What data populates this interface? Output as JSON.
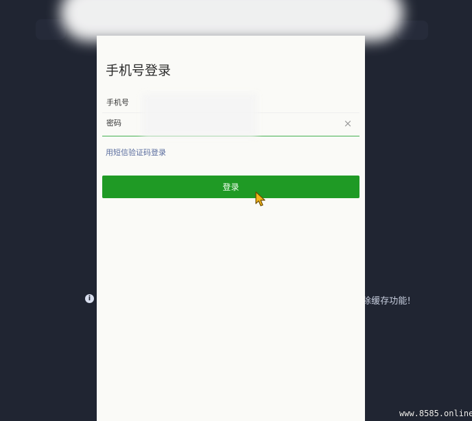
{
  "background": {
    "tip_text": "除缓存功能!",
    "info_icon": "info-icon",
    "colors": {
      "background": "#202532",
      "tip_text": "#c8cfdf"
    }
  },
  "dialog": {
    "title": "手机号登录",
    "phone": {
      "label": "手机号",
      "value": ""
    },
    "password": {
      "label": "密码",
      "value": "",
      "clear_icon": "clear-icon"
    },
    "sms_login_link": "用短信验证码登录",
    "login_button": "登录",
    "colors": {
      "dialog_background": "#fafaf7",
      "primary_button": "#1f9a25",
      "active_underline": "#43b04f",
      "link": "#5b6d9f"
    }
  },
  "watermark": "www.8585.online",
  "pointer": "cursor-icon"
}
